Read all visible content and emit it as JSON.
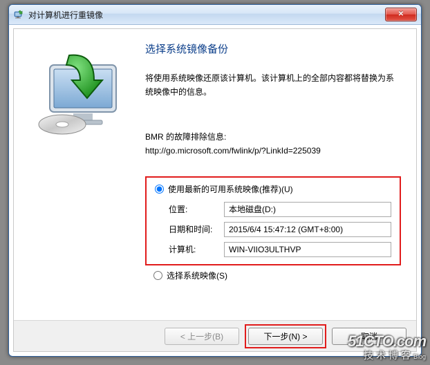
{
  "window": {
    "title": "对计算机进行重镜像"
  },
  "main": {
    "heading": "选择系统镜像备份",
    "desc": "将使用系统映像还原该计算机。该计算机上的全部内容都将替换为系统映像中的信息。",
    "bmr_label": "BMR 的故障排除信息:",
    "bmr_url": "http://go.microsoft.com/fwlink/p/?LinkId=225039"
  },
  "options": {
    "recommended_label": "使用最新的可用系统映像(推荐)(U)",
    "select_label": "选择系统映像(S)",
    "location_label": "位置:",
    "location_value": "本地磁盘(D:)",
    "datetime_label": "日期和时间:",
    "datetime_value": "2015/6/4 15:47:12 (GMT+8:00)",
    "computer_label": "计算机:",
    "computer_value": "WIN-VIIO3ULTHVP"
  },
  "footer": {
    "back": "< 上一步(B)",
    "next": "下一步(N) >",
    "cancel": "取消"
  },
  "watermark": {
    "line1": "51CTO.com",
    "line2": "技术博客",
    "blog": "Blog"
  }
}
